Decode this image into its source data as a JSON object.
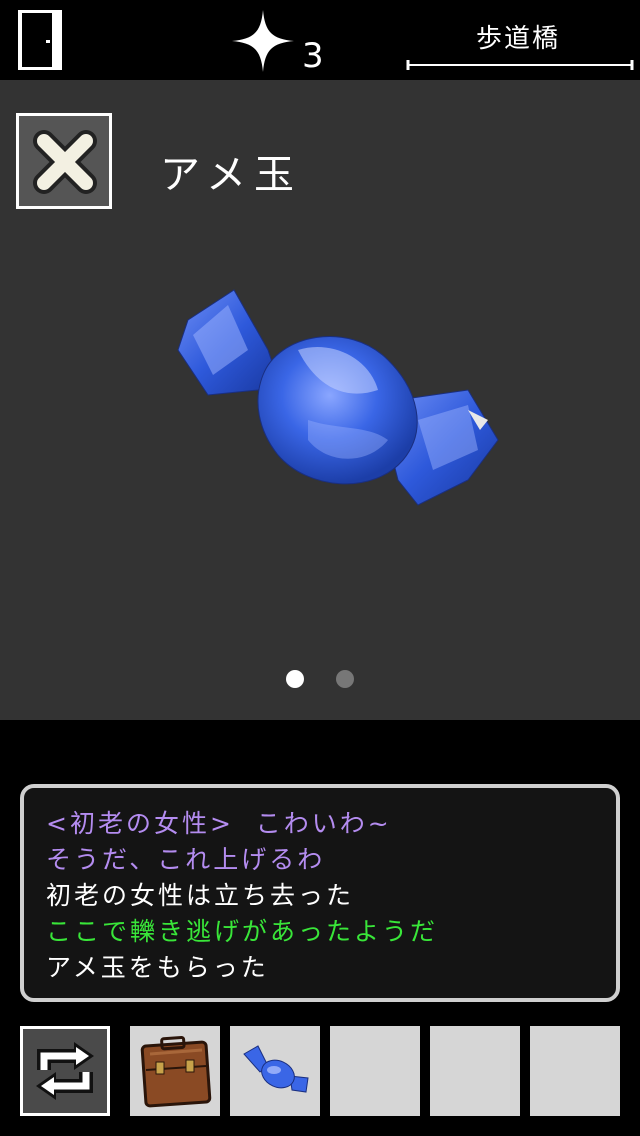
{
  "header": {
    "door_icon": "door-icon",
    "hint_icon": "sparkle-icon",
    "hint_count": "3",
    "location": "歩道橋"
  },
  "item_panel": {
    "close_icon": "close-x-icon",
    "item_name": "アメ玉",
    "item_image": "blue-wrapped-candy",
    "page_count": 2,
    "active_page": 1
  },
  "messages": [
    {
      "text": "<初老の女性>  こわいわ~",
      "color": "#b48cf0"
    },
    {
      "text": "そうだ、これ上げるわ",
      "color": "#b48cf0"
    },
    {
      "text": "初老の女性は立ち去った",
      "color": "#ffffff"
    },
    {
      "text": "ここで轢き逃げがあったようだ",
      "color": "#39e639"
    },
    {
      "text": "アメ玉をもらった",
      "color": "#ffffff"
    }
  ],
  "inventory": {
    "swap_icon": "swap-arrows-icon",
    "slots": [
      {
        "item": "briefcase"
      },
      {
        "item": "candy"
      },
      {
        "item": ""
      },
      {
        "item": ""
      },
      {
        "item": ""
      }
    ]
  },
  "colors": {
    "background": "#000000",
    "panel": "#333333",
    "slot": "#d6d6d6",
    "candy_blue": "#2f5fe0"
  }
}
